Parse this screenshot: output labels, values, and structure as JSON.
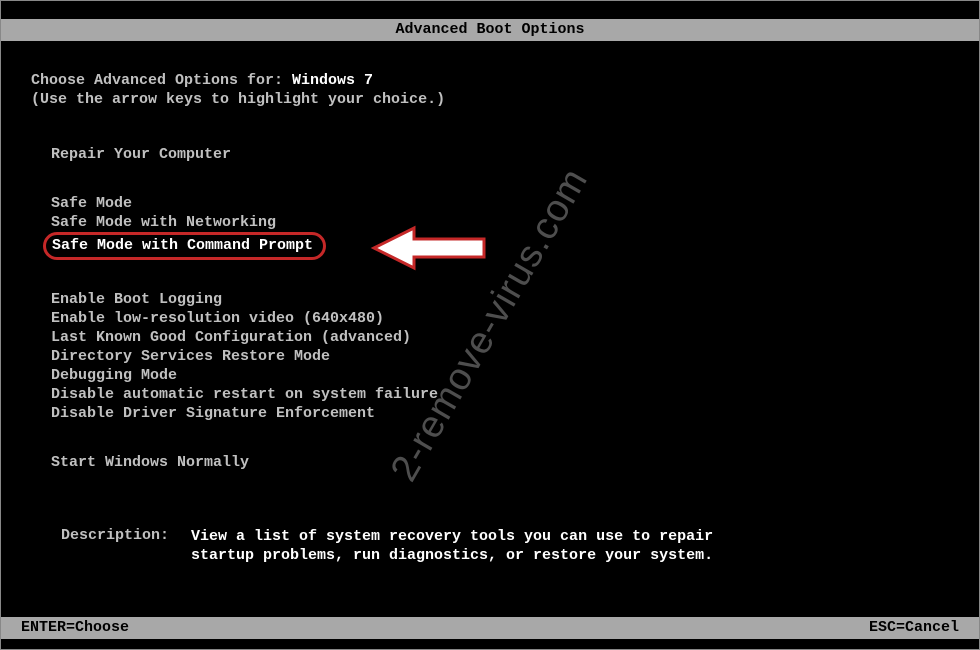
{
  "header": {
    "title": "Advanced Boot Options"
  },
  "intro": {
    "line1_prefix": "Choose Advanced Options for: ",
    "os_name": "Windows 7",
    "line2": "(Use the arrow keys to highlight your choice.)"
  },
  "top_item": "Repair Your Computer",
  "safe_modes": [
    "Safe Mode",
    "Safe Mode with Networking",
    "Safe Mode with Command Prompt"
  ],
  "options_group": [
    "Enable Boot Logging",
    "Enable low-resolution video (640x480)",
    "Last Known Good Configuration (advanced)",
    "Directory Services Restore Mode",
    "Debugging Mode",
    "Disable automatic restart on system failure",
    "Disable Driver Signature Enforcement"
  ],
  "bottom_item": "Start Windows Normally",
  "description": {
    "label": "Description:",
    "text": "View a list of system recovery tools you can use to repair startup problems, run diagnostics, or restore your system."
  },
  "footer": {
    "left": "ENTER=Choose",
    "right": "ESC=Cancel"
  },
  "watermark": "2-remove-virus.com"
}
